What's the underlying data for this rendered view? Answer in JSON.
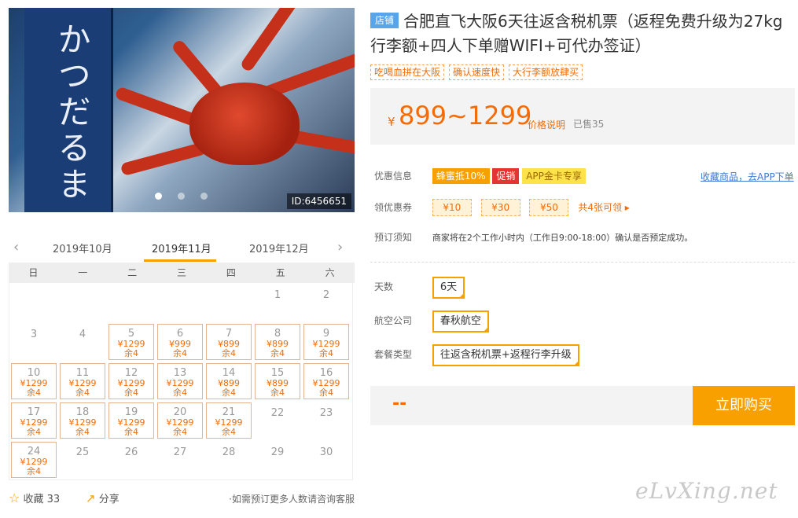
{
  "hero": {
    "image_id": "ID:6456651",
    "dots": 3,
    "active_dot": 0,
    "sign_text": "かつだるま"
  },
  "calendar": {
    "prev_month": "2019年10月",
    "current_month": "2019年11月",
    "next_month": "2019年12月",
    "weekdays": [
      "日",
      "一",
      "二",
      "三",
      "四",
      "五",
      "六"
    ],
    "cells": [
      {
        "d": ""
      },
      {
        "d": ""
      },
      {
        "d": ""
      },
      {
        "d": ""
      },
      {
        "d": ""
      },
      {
        "d": "1"
      },
      {
        "d": "2"
      },
      {
        "d": "3"
      },
      {
        "d": "4"
      },
      {
        "d": "5",
        "p": "¥1299",
        "s": "余4"
      },
      {
        "d": "6",
        "p": "¥999",
        "s": "余4"
      },
      {
        "d": "7",
        "p": "¥899",
        "s": "余4"
      },
      {
        "d": "8",
        "p": "¥899",
        "s": "余4"
      },
      {
        "d": "9",
        "p": "¥1299",
        "s": "余4"
      },
      {
        "d": "10",
        "p": "¥1299",
        "s": "余4"
      },
      {
        "d": "11",
        "p": "¥1299",
        "s": "余4"
      },
      {
        "d": "12",
        "p": "¥1299",
        "s": "余4"
      },
      {
        "d": "13",
        "p": "¥1299",
        "s": "余4"
      },
      {
        "d": "14",
        "p": "¥899",
        "s": "余4"
      },
      {
        "d": "15",
        "p": "¥899",
        "s": "余4"
      },
      {
        "d": "16",
        "p": "¥1299",
        "s": "余4"
      },
      {
        "d": "17",
        "p": "¥1299",
        "s": "余4"
      },
      {
        "d": "18",
        "p": "¥1299",
        "s": "余4"
      },
      {
        "d": "19",
        "p": "¥1299",
        "s": "余4"
      },
      {
        "d": "20",
        "p": "¥1299",
        "s": "余4"
      },
      {
        "d": "21",
        "p": "¥1299",
        "s": "余4"
      },
      {
        "d": "22"
      },
      {
        "d": "23"
      },
      {
        "d": "24",
        "p": "¥1299",
        "s": "余4"
      },
      {
        "d": "25"
      },
      {
        "d": "26"
      },
      {
        "d": "27"
      },
      {
        "d": "28"
      },
      {
        "d": "29"
      },
      {
        "d": "30"
      }
    ]
  },
  "footer": {
    "favorite_label": "收藏",
    "favorite_count": "33",
    "share_label": "分享",
    "contact_note": "如需预订更多人数请咨询客服"
  },
  "product": {
    "store_tag": "店铺",
    "title": "合肥直飞大阪6天往返含税机票（返程免费升级为27kg行李额+四人下单赠WIFI+可代办签证）",
    "highlights": [
      "吃喝血拼在大阪",
      "确认速度快",
      "大行李额放肆买"
    ],
    "price_symbol": "¥",
    "price": "899~1299",
    "price_note": "价格说明",
    "sold": "已售35"
  },
  "promo": {
    "label": "优惠信息",
    "tags": [
      "蜂蜜抵10%",
      "促销",
      "APP金卡专享"
    ],
    "fav_link": "收藏商品，去APP下单"
  },
  "coupons": {
    "label": "领优惠券",
    "items": [
      "¥10",
      "¥30",
      "¥50"
    ],
    "more": "共4张可领"
  },
  "notice": {
    "label": "预订须知",
    "text": "商家将在2个工作小时内（工作日9:00-18:00）确认是否预定成功。"
  },
  "options": {
    "days_label": "天数",
    "days_value": "6天",
    "airline_label": "航空公司",
    "airline_value": "春秋航空",
    "package_label": "套餐类型",
    "package_value": "往返含税机票+返程行李升级"
  },
  "buy": {
    "total": "--",
    "button": "立即购买"
  },
  "watermark": "eLvXing.net",
  "colors": {
    "accent": "#f7a000",
    "price": "#f46c07",
    "store_tag": "#5aa5e8",
    "promo_red": "#e63430"
  }
}
